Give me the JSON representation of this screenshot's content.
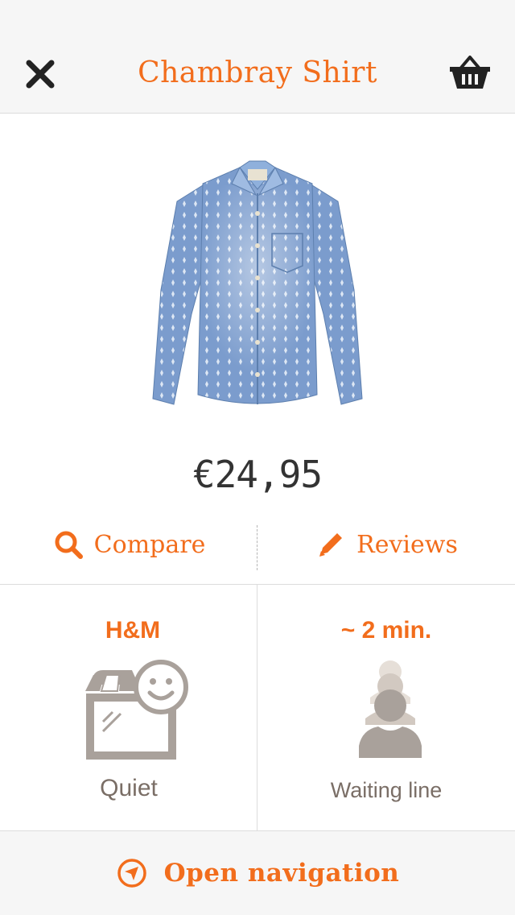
{
  "header": {
    "title": "Chambray Shirt",
    "close_icon": "close-icon",
    "basket_icon": "basket-icon"
  },
  "product": {
    "image": "chambray-shirt-image",
    "price": "€24,95"
  },
  "actions": {
    "compare_label": "Compare",
    "compare_icon": "search-icon",
    "reviews_label": "Reviews",
    "reviews_icon": "pencil-icon"
  },
  "store": {
    "name": "H&M",
    "status": "Quiet",
    "icon": "store-smiley-icon"
  },
  "queue": {
    "wait_time": "~ 2 min.",
    "label": "Waiting line",
    "icon": "waiting-line-icon"
  },
  "footer": {
    "navigation_label": "Open navigation",
    "navigation_icon": "navigation-arrow-icon"
  },
  "colors": {
    "accent": "#f26d1c",
    "text_dark": "#333333",
    "icon_gray": "#a9a19b",
    "background_bar": "#f6f6f6"
  }
}
